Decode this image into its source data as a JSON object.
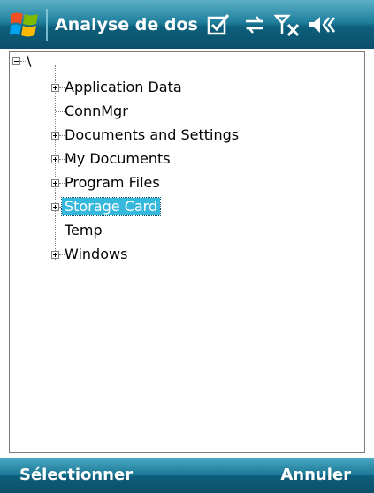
{
  "titlebar": {
    "title": "Analyse de dossie",
    "icons": [
      "windows-start-icon",
      "task-check-icon",
      "connectivity-icon",
      "signal-off-icon",
      "volume-icon"
    ]
  },
  "tree": {
    "root": {
      "label": "\\",
      "expanded": true
    },
    "items": [
      {
        "label": "Application Data",
        "expandable": true
      },
      {
        "label": "ConnMgr",
        "expandable": false
      },
      {
        "label": "Documents and Settings",
        "expandable": true
      },
      {
        "label": "My Documents",
        "expandable": true
      },
      {
        "label": "Program Files",
        "expandable": true
      },
      {
        "label": "Storage Card",
        "expandable": true,
        "selected": true
      },
      {
        "label": "Temp",
        "expandable": false
      },
      {
        "label": "Windows",
        "expandable": true
      }
    ],
    "selection_color": "#35b8dc"
  },
  "softkeys": {
    "left": "Sélectionner",
    "right": "Annuler"
  },
  "colors": {
    "bar_dark": "#0a4f69",
    "bar_light": "#5bb0c8"
  }
}
